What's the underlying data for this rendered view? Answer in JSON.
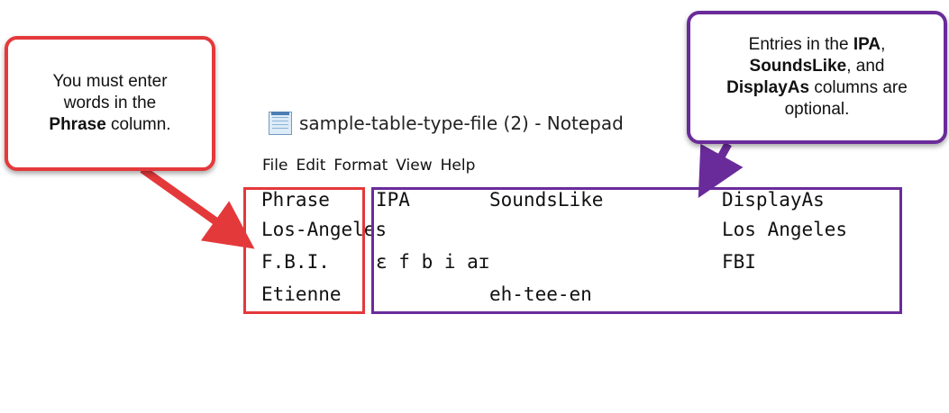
{
  "notepad": {
    "title": "sample-table-type-file (2) - Notepad",
    "icon": "notepad-icon",
    "menu": [
      "File",
      "Edit",
      "Format",
      "View",
      "Help"
    ],
    "rows": [
      [
        "Phrase",
        "IPA",
        "SoundsLike",
        "DisplayAs"
      ],
      [
        "Los-Angeles",
        "",
        "",
        "Los Angeles"
      ],
      [
        "F.B.I.",
        "ɛ f b i aɪ",
        "",
        "FBI"
      ],
      [
        "Etienne",
        "",
        "eh-tee-en",
        ""
      ]
    ]
  },
  "callouts": {
    "red": {
      "line1": "You must enter",
      "line2": "words in the",
      "bold": "Phrase",
      "after_bold": " column."
    },
    "purple": {
      "pre": "Entries in the ",
      "bold1": "IPA",
      "mid1": ",",
      "bold2": "SoundsLike",
      "mid2": ", and",
      "bold3": "DisplayAs",
      "after": " columns are",
      "end": "optional."
    }
  },
  "colors": {
    "red_accent": "#e4393b",
    "purple_accent": "#6a2b9a"
  }
}
